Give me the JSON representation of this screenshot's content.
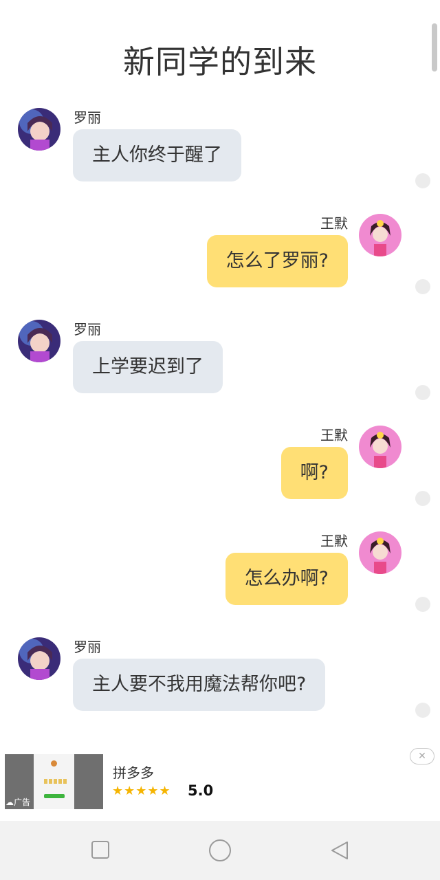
{
  "title": "新同学的到来",
  "messages": [
    {
      "side": "left",
      "name": "罗丽",
      "text": "主人你终于醒了"
    },
    {
      "side": "right",
      "name": "王默",
      "text": "怎么了罗丽?"
    },
    {
      "side": "left",
      "name": "罗丽",
      "text": "上学要迟到了"
    },
    {
      "side": "right",
      "name": "王默",
      "text": "啊?"
    },
    {
      "side": "right",
      "name": "王默",
      "text": "怎么办啊?"
    },
    {
      "side": "left",
      "name": "罗丽",
      "text": "主人要不我用魔法帮你吧?"
    }
  ],
  "ad": {
    "app_name": "拼多多",
    "rating": "5.0",
    "stars": 5,
    "badge": "广告"
  },
  "colors": {
    "left_bubble": "#e4e9ef",
    "right_bubble": "#ffdf75",
    "star": "#f5b400"
  },
  "icons": {
    "nav_left": "square-icon",
    "nav_center": "circle-icon",
    "nav_right": "triangle-back-icon",
    "ad_close": "close-icon"
  }
}
